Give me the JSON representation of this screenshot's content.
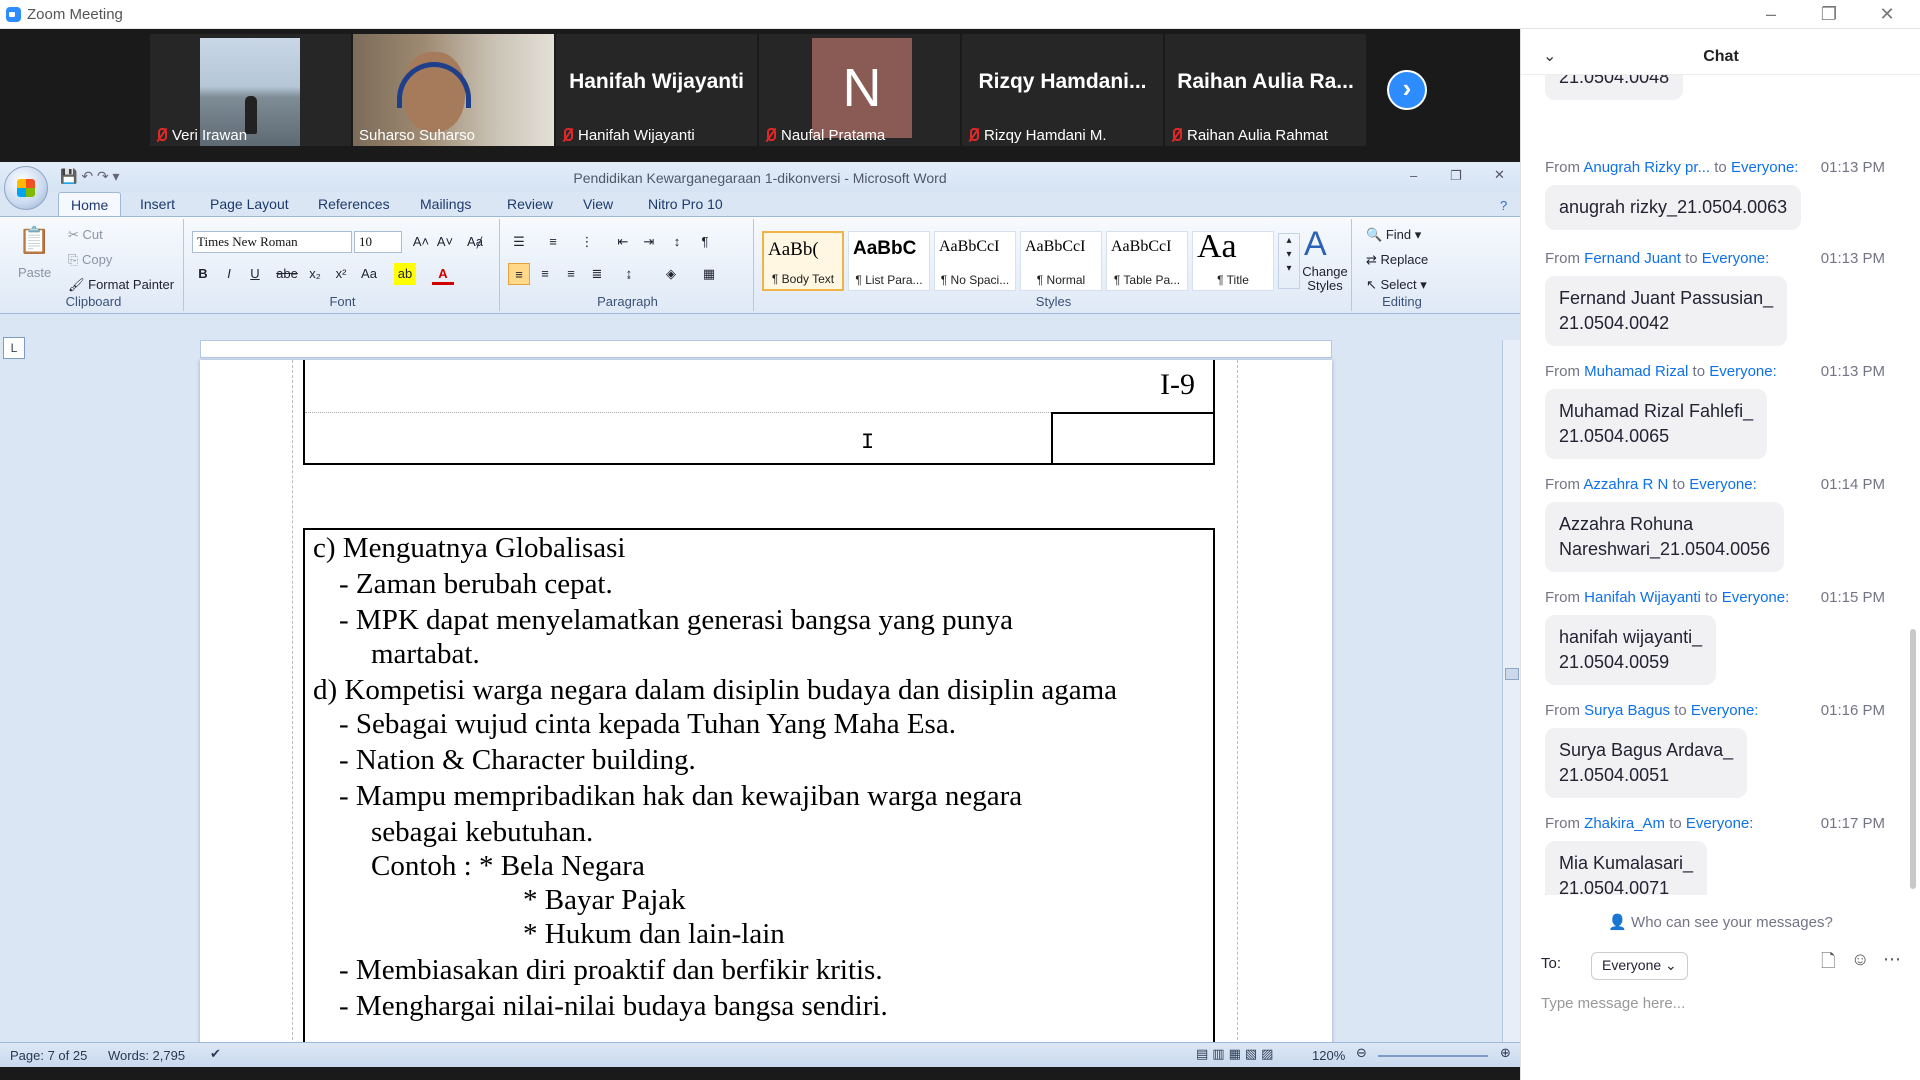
{
  "window": {
    "title": "Zoom Meeting"
  },
  "participants": [
    {
      "name": "Veri Irawan",
      "type": "video"
    },
    {
      "name": "Suharso Suharso",
      "type": "video"
    },
    {
      "name": "Hanifah Wijayanti",
      "display": "Hanifah Wijayanti",
      "type": "name"
    },
    {
      "name": "Naufal Pratama",
      "avatar": "N",
      "type": "avatar"
    },
    {
      "name": "Rizqy Hamdani M.",
      "display": "Rizqy  Hamdani...",
      "type": "name"
    },
    {
      "name": "Raihan Aulia Rahmat",
      "display": "Raihan  Aulia  Ra...",
      "type": "name"
    }
  ],
  "word": {
    "title": "Pendidikan Kewarganegaraan 1-dikonversi - Microsoft Word",
    "tabs": [
      "Home",
      "Insert",
      "Page Layout",
      "References",
      "Mailings",
      "Review",
      "View",
      "Nitro Pro 10"
    ],
    "clipboard": {
      "paste": "Paste",
      "cut": "Cut",
      "copy": "Copy",
      "format_painter": "Format Painter",
      "label": "Clipboard"
    },
    "font": {
      "name": "Times New Roman",
      "size": "10",
      "label": "Font"
    },
    "paragraph": {
      "label": "Paragraph"
    },
    "styles": {
      "label": "Styles",
      "items": [
        {
          "preview": "AaBb(",
          "name": "¶ Body Text"
        },
        {
          "preview": "AaBbC",
          "name": "¶ List Para..."
        },
        {
          "preview": "AaBbCcI",
          "name": "¶ No Spaci..."
        },
        {
          "preview": "AaBbCcI",
          "name": "¶ Normal"
        },
        {
          "preview": "AaBbCcI",
          "name": "¶ Table Pa..."
        },
        {
          "preview": "Aa",
          "name": "¶ Title"
        }
      ],
      "change": "Change Styles"
    },
    "editing": {
      "find": "Find",
      "replace": "Replace",
      "select": "Select",
      "label": "Editing"
    },
    "page_number": "I-9",
    "content": [
      "c) Menguatnya Globalisasi",
      "-   Zaman berubah cepat.",
      "-   MPK dapat menyelamatkan generasi bangsa yang punya",
      "martabat.",
      "d) Kompetisi warga negara dalam disiplin budaya dan disiplin agama",
      "-   Sebagai wujud cinta kepada Tuhan Yang Maha Esa.",
      "-   Nation & Character building.",
      "-   Mampu mempribadikan hak dan kewajiban warga negara",
      "sebagai kebutuhan.",
      "Contoh :     * Bela Negara",
      "* Bayar Pajak",
      "* Hukum dan lain-lain",
      "-   Membiasakan diri proaktif dan berfikir kritis.",
      "-   Menghargai nilai-nilai budaya bangsa sendiri."
    ],
    "status": {
      "page": "Page: 7 of 25",
      "words": "Words: 2,795",
      "zoom": "120%"
    }
  },
  "chat": {
    "title": "Chat",
    "top_bubble": "21.0504.0048",
    "messages": [
      {
        "from": "Anugrah Rizky pr...",
        "to": "Everyone:",
        "time": "01:13 PM",
        "text": [
          "anugrah rizky_21.0504.0063"
        ]
      },
      {
        "from": "Fernand Juant",
        "to": "Everyone:",
        "time": "01:13 PM",
        "text": [
          "Fernand Juant Passusian_",
          "21.0504.0042"
        ]
      },
      {
        "from": "Muhamad Rizal",
        "to": "Everyone:",
        "time": "01:13 PM",
        "text": [
          "Muhamad Rizal Fahlefi_",
          "21.0504.0065"
        ]
      },
      {
        "from": "Azzahra R N",
        "to": "Everyone:",
        "time": "01:14 PM",
        "text": [
          "Azzahra Rohuna",
          "Nareshwari_21.0504.0056"
        ]
      },
      {
        "from": "Hanifah Wijayanti",
        "to": "Everyone:",
        "time": "01:15 PM",
        "text": [
          "hanifah wijayanti_",
          "21.0504.0059"
        ]
      },
      {
        "from": "Surya Bagus",
        "to": "Everyone:",
        "time": "01:16 PM",
        "text": [
          "Surya Bagus Ardava_",
          "21.0504.0051"
        ]
      },
      {
        "from": "Zhakira_Am",
        "to": "Everyone:",
        "time": "01:17 PM",
        "text": [
          "Mia Kumalasari_",
          "21.0504.0071"
        ]
      }
    ],
    "who_can_see": "Who can see your messages?",
    "to_label": "To:",
    "to_value": "Everyone",
    "placeholder": "Type message here..."
  },
  "colors": {
    "zoom_blue": "#2d8cff",
    "link_blue": "#0e71eb",
    "muted_red": "#e02828"
  }
}
